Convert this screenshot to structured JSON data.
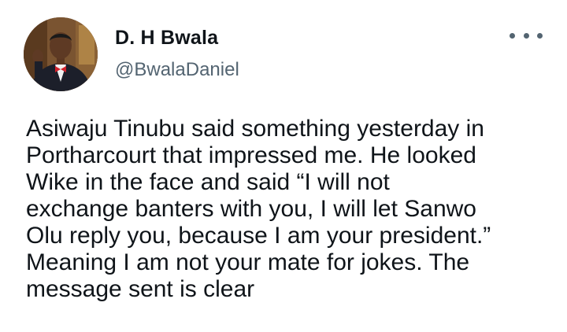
{
  "tweet": {
    "author": {
      "name": "D. H Bwala",
      "handle": "@BwalaDaniel",
      "avatar_icon": "profile-photo"
    },
    "more_icon": "more-horizontal-icon",
    "text": "Asiwaju Tinubu said something yesterday in\nPortharcourt that impressed me. He looked\nWike in the face and said “I will not\nexchange banters with you, I will let Sanwo\nOlu reply you, because I am your president.”\nMeaning I am not your mate for jokes. The\nmessage sent is clear"
  },
  "colors": {
    "text": "#0f1419",
    "secondary": "#536471",
    "background": "#ffffff"
  }
}
